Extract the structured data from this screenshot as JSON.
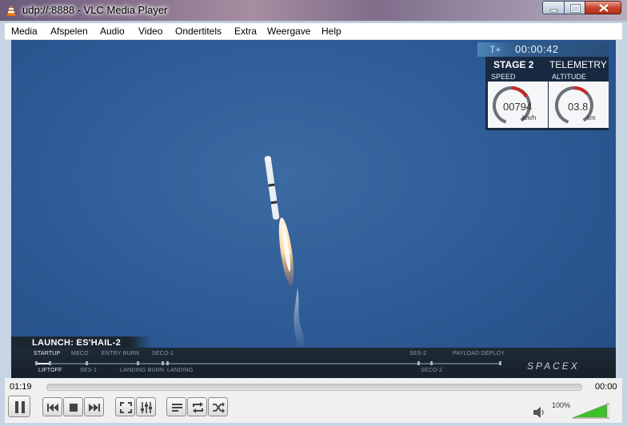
{
  "window": {
    "title": "udp://:8888 - VLC Media Player",
    "icon": "vlc-cone-icon"
  },
  "menu": {
    "items": [
      "Media",
      "Afspelen",
      "Audio",
      "Video",
      "Ondertitels",
      "Extra",
      "Weergave",
      "Help"
    ]
  },
  "video": {
    "hud": {
      "t_label": "T+",
      "time": "00:00:42",
      "stage": "STAGE 2",
      "telemetry": "TELEMETRY",
      "speed_label": "SPEED",
      "altitude_label": "ALTITUDE",
      "speed_value": "00794",
      "speed_unit": "km/h",
      "altitude_value": "03.8",
      "altitude_unit": "km"
    },
    "launch_label": "LAUNCH: ES'HAIL-2",
    "timeline_events_top": [
      "STARTUP",
      "MECO",
      "ENTRY BURN",
      "SECO-1",
      "SES-2",
      "PAYLOAD DEPLOY"
    ],
    "timeline_events_bottom": [
      "LIFTOFF",
      "SES-1",
      "LANDING BURN",
      "LANDING",
      "SECO-2"
    ],
    "brand": "SPACEX"
  },
  "controls": {
    "elapsed": "01:19",
    "remaining": "00:00",
    "volume_percent": "100%",
    "volume_level": 1.0,
    "buttons": [
      "pause-icon",
      "previous-icon",
      "stop-icon",
      "next-icon",
      "fullscreen-icon",
      "extended-settings-icon",
      "playlist-icon",
      "loop-icon",
      "shuffle-icon"
    ]
  },
  "colors": {
    "volume_green": "#3fbf2a",
    "close_red": "#c7462f",
    "sky_blue": "#2f5d97"
  }
}
